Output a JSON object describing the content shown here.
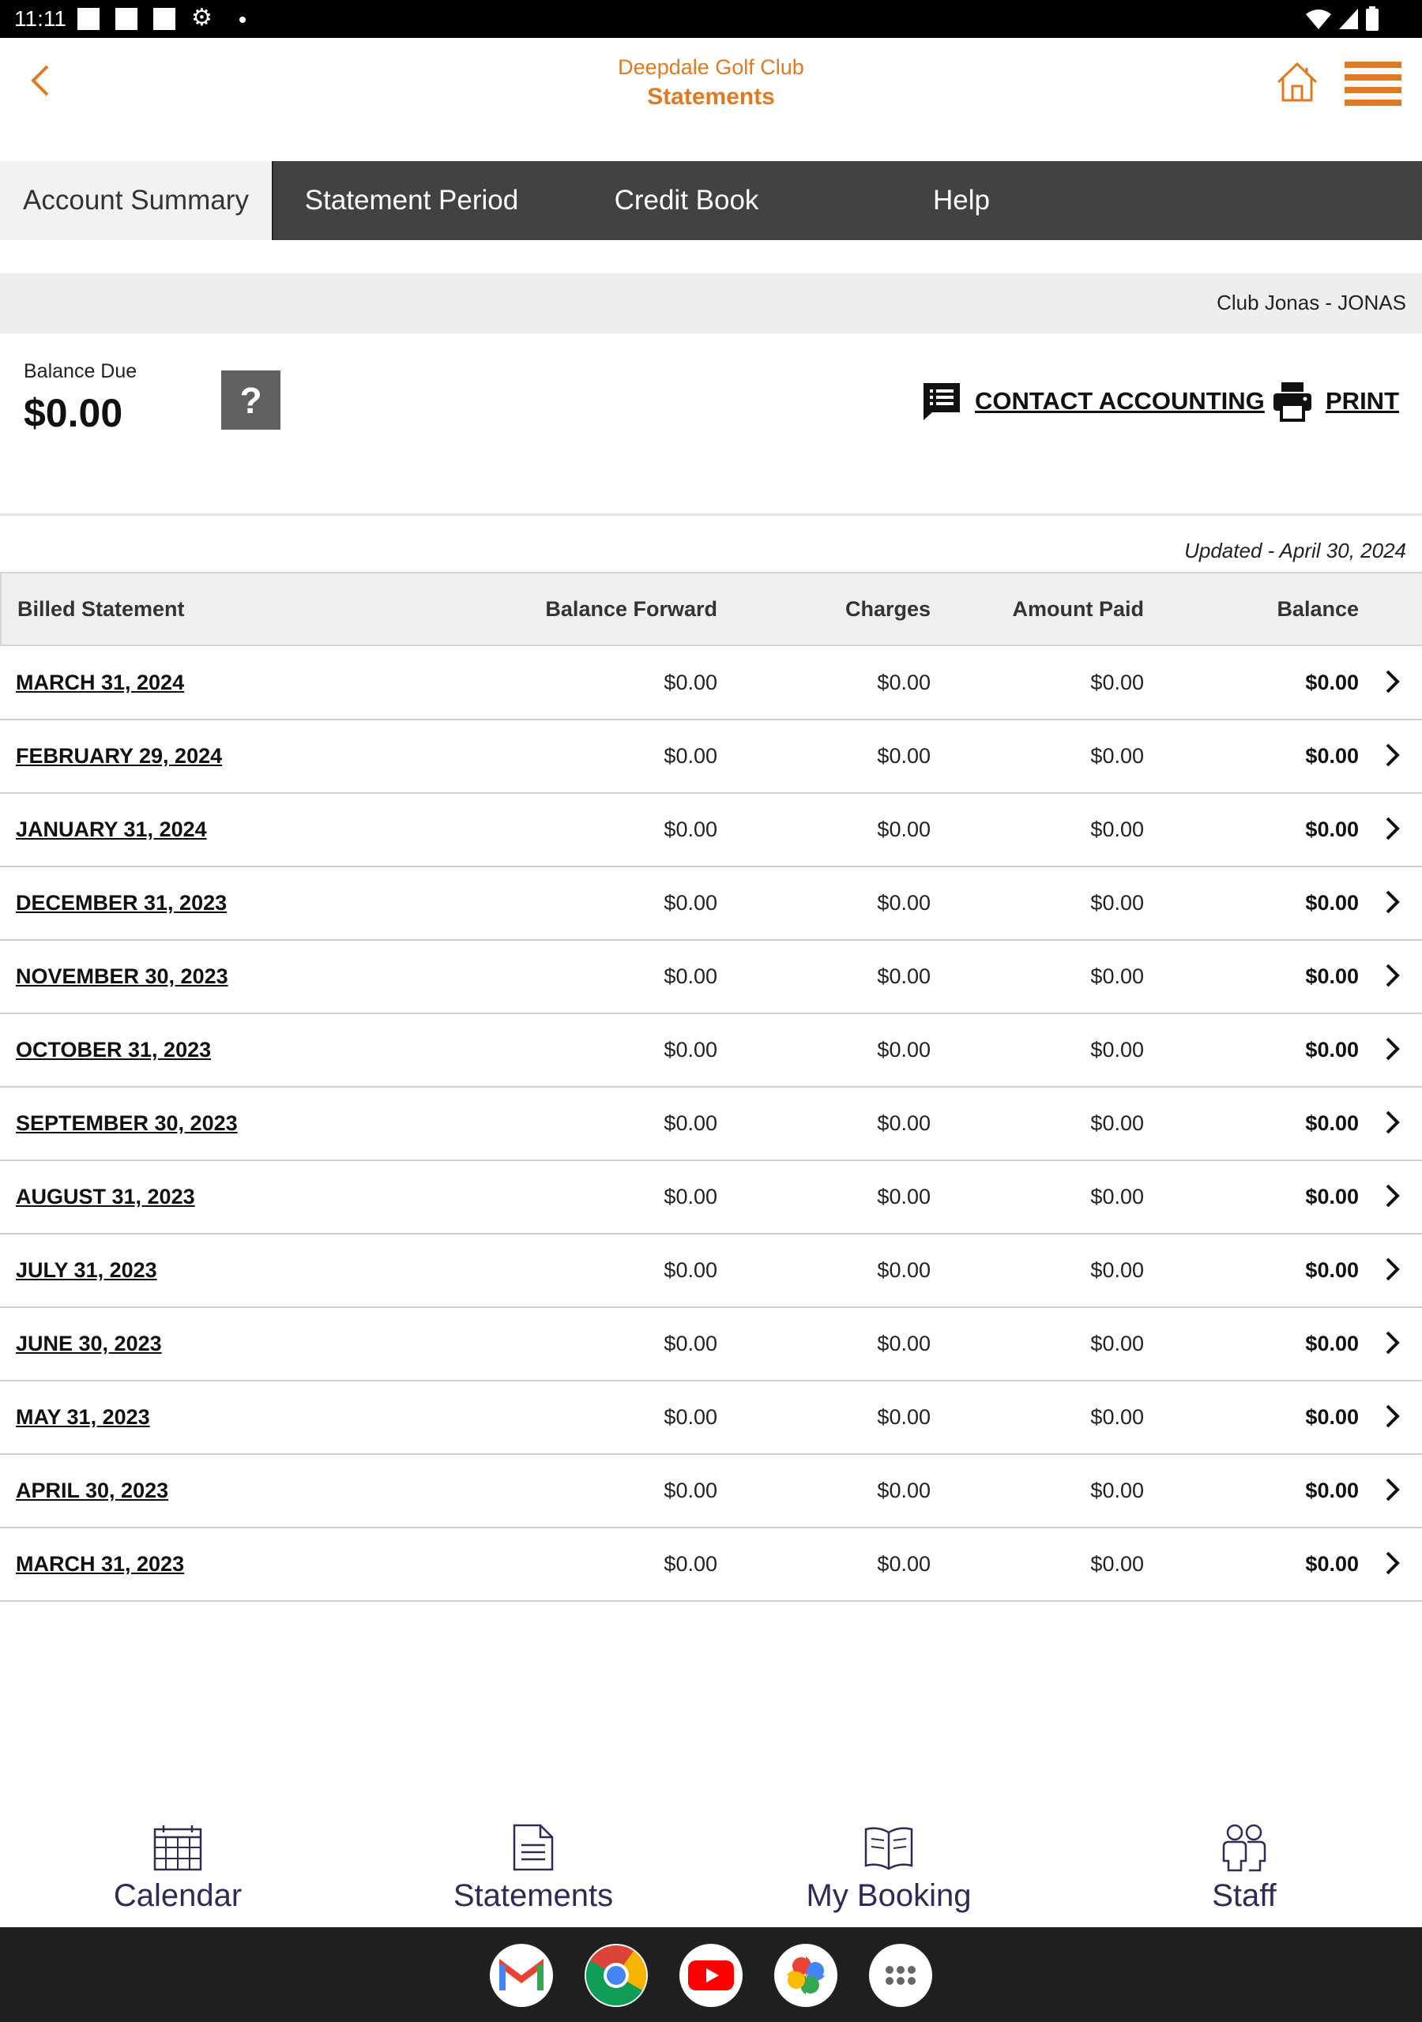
{
  "status_bar": {
    "time": "11:11"
  },
  "header": {
    "club_name": "Deepdale Golf Club",
    "title": "Statements",
    "accent_color": "#e07a22"
  },
  "tabs": [
    {
      "label": "Account Summary",
      "active": true
    },
    {
      "label": "Statement Period",
      "active": false
    },
    {
      "label": "Credit Book",
      "active": false
    },
    {
      "label": "Help",
      "active": false
    }
  ],
  "club_bar": {
    "text": "Club Jonas - JONAS"
  },
  "balance": {
    "label": "Balance Due",
    "value": "$0.00",
    "help_symbol": "?"
  },
  "actions": {
    "contact_label": "CONTACT ACCOUNTING",
    "print_label": "PRINT"
  },
  "updated_text": "Updated - April 30, 2024",
  "table": {
    "headers": {
      "statement": "Billed Statement",
      "balance_forward": "Balance Forward",
      "charges": "Charges",
      "amount_paid": "Amount Paid",
      "balance": "Balance"
    },
    "rows": [
      {
        "date": "MARCH 31, 2024",
        "balance_forward": "$0.00",
        "charges": "$0.00",
        "amount_paid": "$0.00",
        "balance": "$0.00"
      },
      {
        "date": "FEBRUARY 29, 2024",
        "balance_forward": "$0.00",
        "charges": "$0.00",
        "amount_paid": "$0.00",
        "balance": "$0.00"
      },
      {
        "date": "JANUARY 31, 2024",
        "balance_forward": "$0.00",
        "charges": "$0.00",
        "amount_paid": "$0.00",
        "balance": "$0.00"
      },
      {
        "date": "DECEMBER 31, 2023",
        "balance_forward": "$0.00",
        "charges": "$0.00",
        "amount_paid": "$0.00",
        "balance": "$0.00"
      },
      {
        "date": "NOVEMBER 30, 2023",
        "balance_forward": "$0.00",
        "charges": "$0.00",
        "amount_paid": "$0.00",
        "balance": "$0.00"
      },
      {
        "date": "OCTOBER 31, 2023",
        "balance_forward": "$0.00",
        "charges": "$0.00",
        "amount_paid": "$0.00",
        "balance": "$0.00"
      },
      {
        "date": "SEPTEMBER 30, 2023",
        "balance_forward": "$0.00",
        "charges": "$0.00",
        "amount_paid": "$0.00",
        "balance": "$0.00"
      },
      {
        "date": "AUGUST 31, 2023",
        "balance_forward": "$0.00",
        "charges": "$0.00",
        "amount_paid": "$0.00",
        "balance": "$0.00"
      },
      {
        "date": "JULY 31, 2023",
        "balance_forward": "$0.00",
        "charges": "$0.00",
        "amount_paid": "$0.00",
        "balance": "$0.00"
      },
      {
        "date": "JUNE 30, 2023",
        "balance_forward": "$0.00",
        "charges": "$0.00",
        "amount_paid": "$0.00",
        "balance": "$0.00"
      },
      {
        "date": "MAY 31, 2023",
        "balance_forward": "$0.00",
        "charges": "$0.00",
        "amount_paid": "$0.00",
        "balance": "$0.00"
      },
      {
        "date": "APRIL 30, 2023",
        "balance_forward": "$0.00",
        "charges": "$0.00",
        "amount_paid": "$0.00",
        "balance": "$0.00"
      },
      {
        "date": "MARCH 31, 2023",
        "balance_forward": "$0.00",
        "charges": "$0.00",
        "amount_paid": "$0.00",
        "balance": "$0.00"
      }
    ]
  },
  "bottom_nav": [
    {
      "label": "Calendar",
      "icon": "calendar-icon"
    },
    {
      "label": "Statements",
      "icon": "document-icon"
    },
    {
      "label": "My Booking",
      "icon": "book-icon"
    },
    {
      "label": "Staff",
      "icon": "people-icon"
    }
  ],
  "dock_apps": [
    {
      "icon": "gmail-icon"
    },
    {
      "icon": "chrome-icon"
    },
    {
      "icon": "youtube-icon"
    },
    {
      "icon": "photos-icon"
    },
    {
      "icon": "app-drawer-icon"
    }
  ]
}
